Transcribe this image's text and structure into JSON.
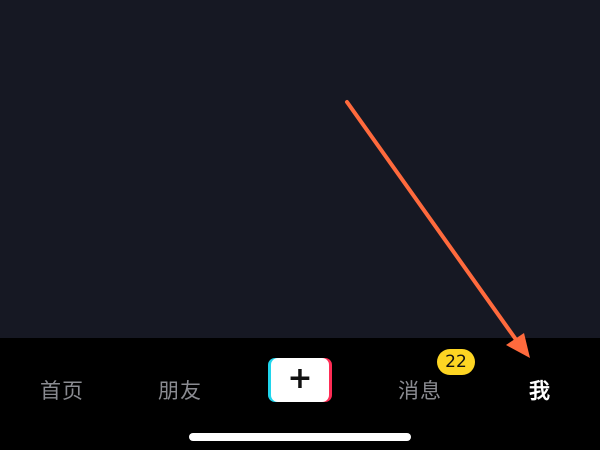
{
  "tab_bar": {
    "tabs": [
      {
        "label": "首页"
      },
      {
        "label": "朋友"
      },
      {
        "label": "消息"
      },
      {
        "label": "我"
      }
    ],
    "create_symbol": "+",
    "messages_badge": "22"
  },
  "icons": {
    "create": "plus-icon",
    "annotation": "arrow-icon"
  },
  "colors": {
    "background": "#161823",
    "tab_bar_background": "#000000",
    "tab_inactive": "#8a8b91",
    "tab_active": "#ffffff",
    "badge": "#fdd523",
    "create_cyan": "#20d5ec",
    "create_red": "#fe2c55",
    "annotation_arrow": "#ff6a3d"
  }
}
